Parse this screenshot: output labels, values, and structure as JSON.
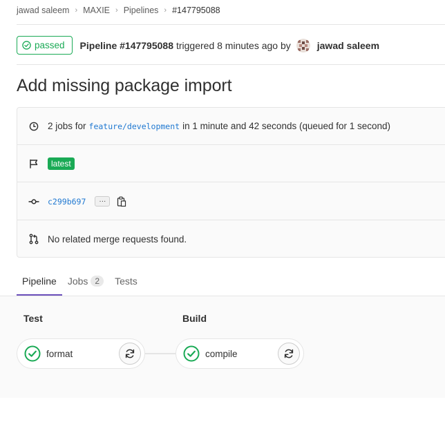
{
  "breadcrumb": {
    "items": [
      "jawad saleem",
      "MAXIE",
      "Pipelines",
      "#147795088"
    ]
  },
  "header": {
    "status": "passed",
    "pipeline_label": "Pipeline #147795088",
    "triggered_text": "triggered 8 minutes ago by",
    "author": "jawad saleem"
  },
  "title": "Add missing package import",
  "info": {
    "jobs_prefix": "2 jobs for",
    "branch": "feature/development",
    "jobs_suffix": "in 1 minute and 42 seconds (queued for 1 second)",
    "latest_badge": "latest",
    "commit_sha": "c299b697",
    "ellipsis": "···",
    "merge_text": "No related merge requests found."
  },
  "tabs": {
    "pipeline": "Pipeline",
    "jobs": "Jobs",
    "jobs_count": "2",
    "tests": "Tests"
  },
  "stages": [
    {
      "title": "Test",
      "job": "format"
    },
    {
      "title": "Build",
      "job": "compile"
    }
  ],
  "colors": {
    "success": "#1aaa55",
    "link": "#1f78d1",
    "tab_underline": "#6b4fbb"
  }
}
